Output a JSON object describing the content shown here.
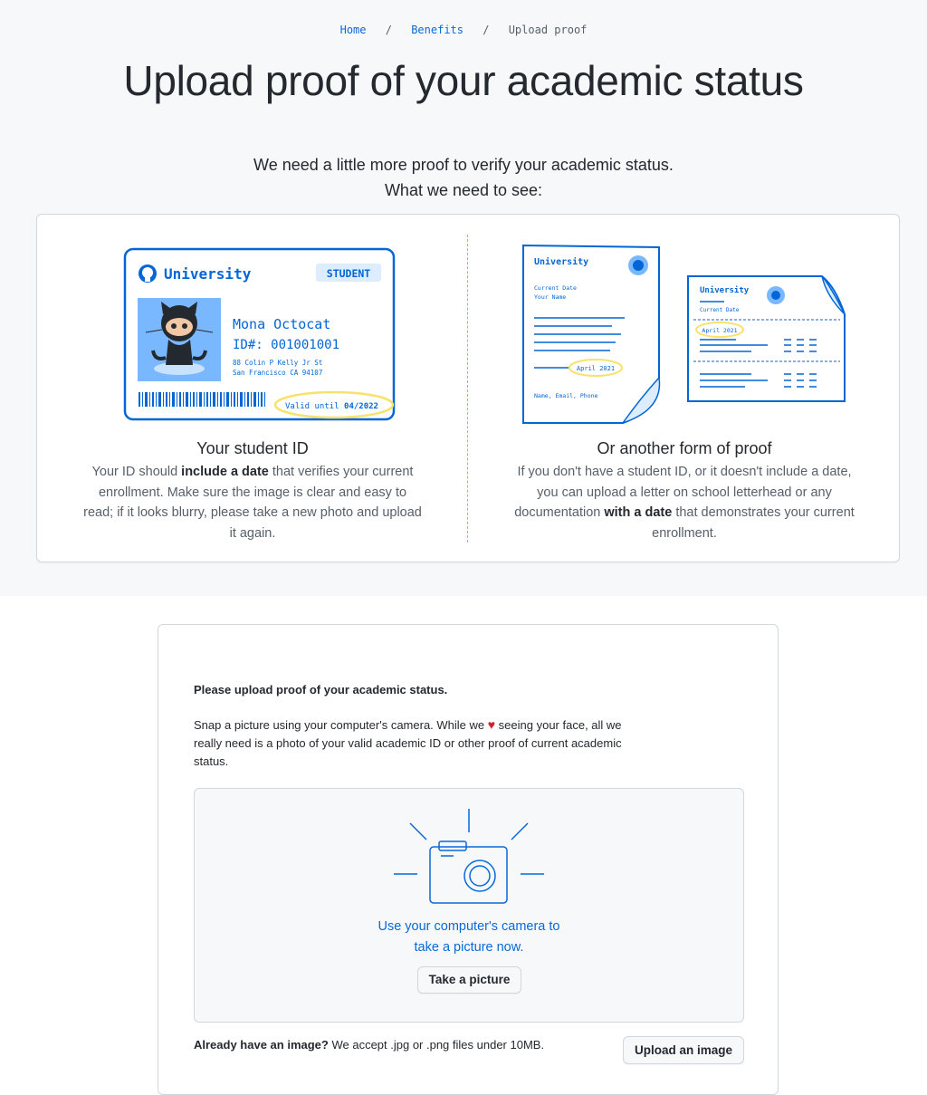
{
  "breadcrumb": {
    "home": "Home",
    "benefits": "Benefits",
    "current": "Upload proof",
    "separator": "/"
  },
  "page_title": "Upload proof of your academic status",
  "intro": {
    "line1": "We need a little more proof to verify your academic status.",
    "line2": "What we need to see:"
  },
  "student_id": {
    "title": "Your student ID",
    "text_before": "Your ID should ",
    "text_bold": "include a date",
    "text_after": " that verifies your current enrollment. Make sure the image is clear and easy to read; if it looks blurry, please take a new photo and upload it again.",
    "card": {
      "university": "University",
      "badge": "STUDENT",
      "name": "Mona Octocat",
      "id": "ID#: 001001001",
      "address1": "88 Colin P Kelly Jr St",
      "address2": "San Francisco CA 94107",
      "valid_label": "Valid until ",
      "valid_date": "04/2022"
    }
  },
  "other_proof": {
    "title": "Or another form of proof",
    "text_before": "If you don't have a student ID, or it doesn't include a date, you can upload a letter on school letterhead or any documentation ",
    "text_bold": "with a date",
    "text_after": " that demonstrates your current enrollment.",
    "doc1": {
      "university": "University",
      "current_date": "Current Date",
      "your_name": "Your Name",
      "date": "April 2021",
      "footer": "Name, Email, Phone"
    },
    "doc2": {
      "university": "University",
      "current_date": "Current Date",
      "date": "April 2021"
    }
  },
  "upload": {
    "heading": "Please upload proof of your academic status.",
    "text_before": "Snap a picture using your computer's camera. While we ",
    "heart": "♥",
    "text_after": " seeing your face, all we really need is a photo of your valid academic ID or other proof of current academic status.",
    "camera_line1": "Use your computer's camera to",
    "camera_line2": "take a picture now.",
    "take_picture": "Take a picture",
    "already_bold": "Already have an image?",
    "already_rest": " We accept .jpg or .png files under 10MB.",
    "upload_button": "Upload an image"
  },
  "colors": {
    "accent": "#0969da",
    "illustration_blue": "#0366d6",
    "highlight_yellow": "#f9e26b",
    "heart": "#cf222e"
  }
}
